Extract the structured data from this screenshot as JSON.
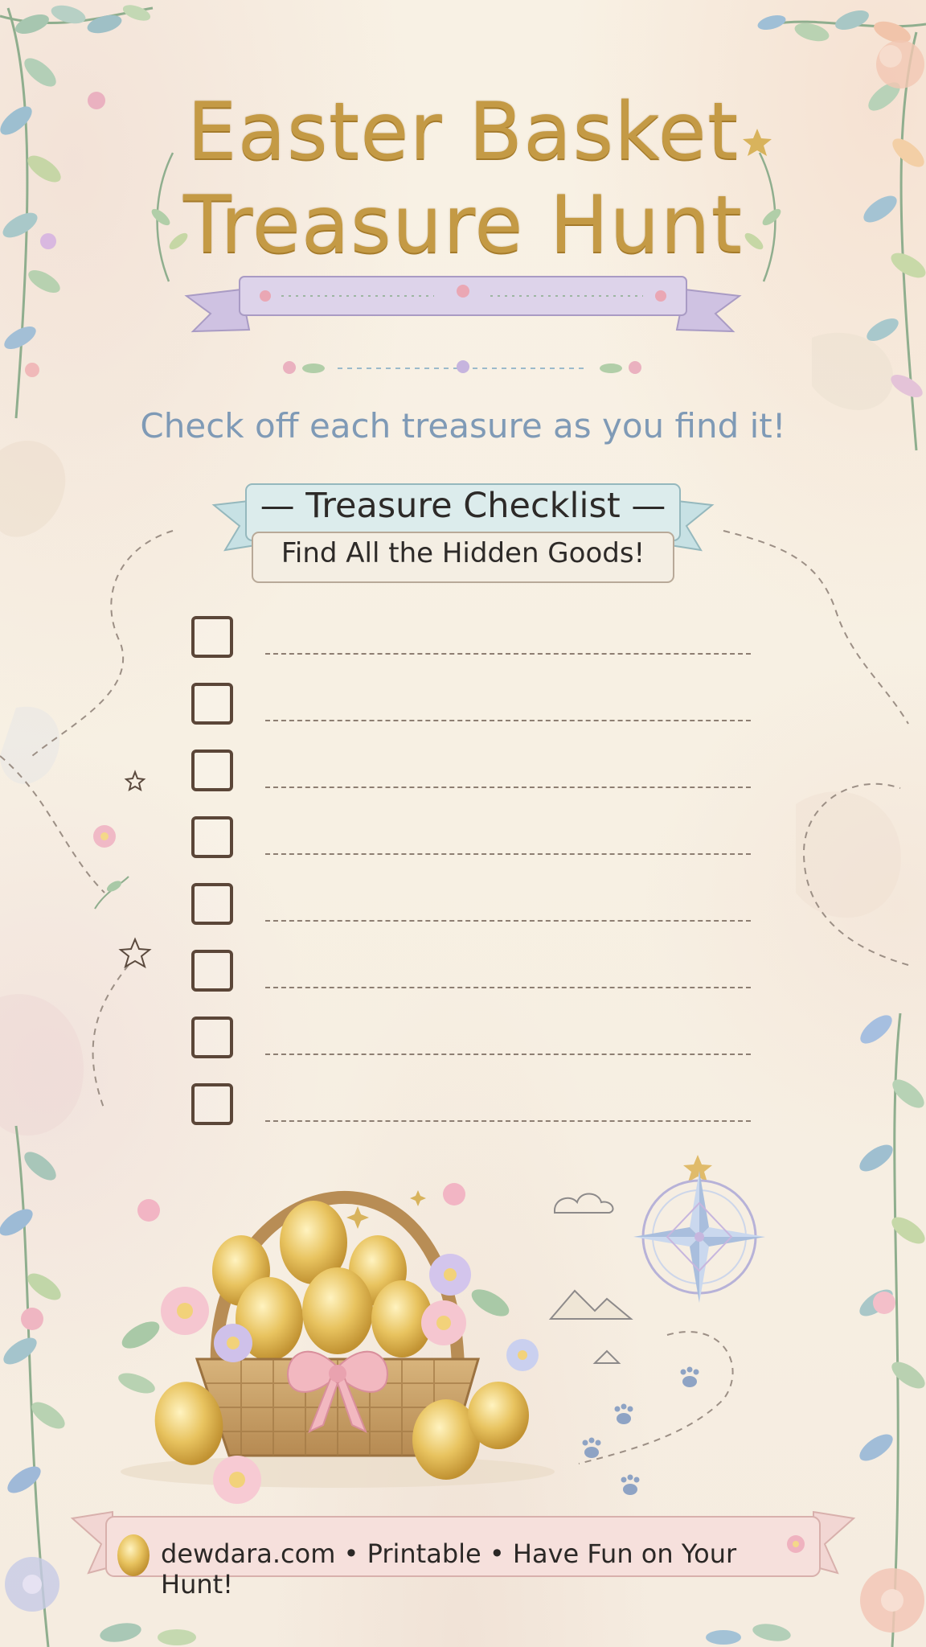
{
  "title": {
    "line1": "Easter Basket",
    "line2": "Treasure Hunt"
  },
  "subtitle": "Check off each treasure as you find it!",
  "checklist_banner": {
    "title": "— Treasure Checklist —",
    "subtitle": "Find All the Hidden Goods!"
  },
  "checklist": {
    "items": [
      {
        "checked": false,
        "text": ""
      },
      {
        "checked": false,
        "text": ""
      },
      {
        "checked": false,
        "text": ""
      },
      {
        "checked": false,
        "text": ""
      },
      {
        "checked": false,
        "text": ""
      },
      {
        "checked": false,
        "text": ""
      },
      {
        "checked": false,
        "text": ""
      },
      {
        "checked": false,
        "text": ""
      }
    ]
  },
  "footer": {
    "text": "dewdara.com • Printable • Have Fun on Your Hunt!"
  },
  "colors": {
    "title_gold": "#c49a45",
    "subtitle_blue": "#7f9ab6",
    "ribbon_lavender": "#ddd3ea",
    "ribbon_mint": "#c7e1e4",
    "ribbon_pink": "#f2d6d3",
    "paper": "#f7f0e3"
  },
  "icons": [
    "leaf-vine-icon",
    "flower-icon",
    "basket-icon",
    "egg-icon",
    "compass-rose-icon",
    "paw-print-icon",
    "star-icon",
    "cloud-icon",
    "mountain-icon"
  ]
}
